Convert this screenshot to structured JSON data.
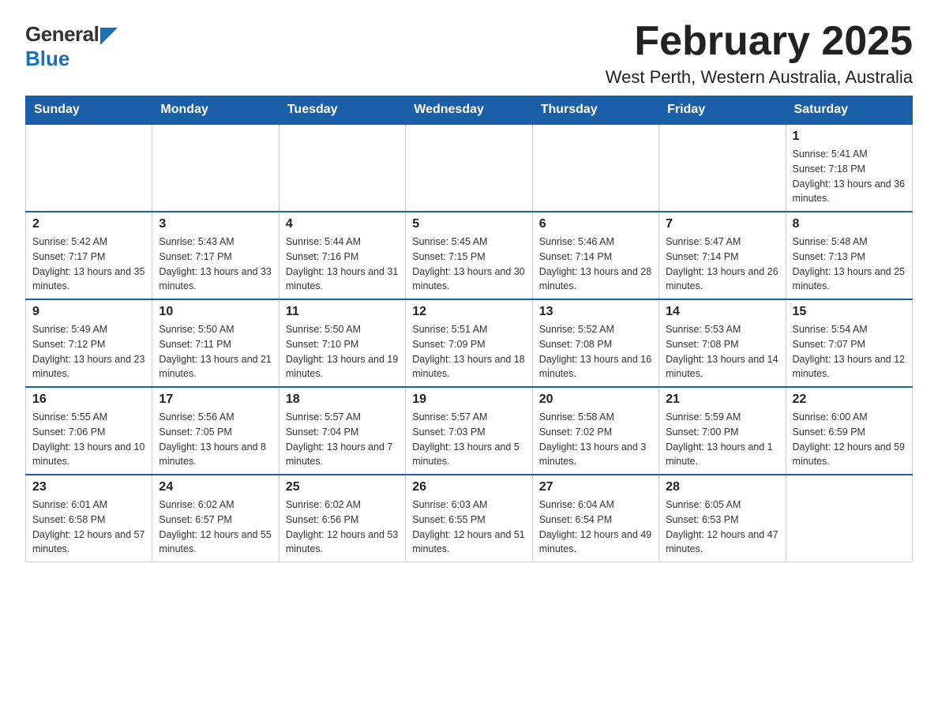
{
  "header": {
    "logo_general": "General",
    "logo_blue": "Blue",
    "title": "February 2025",
    "subtitle": "West Perth, Western Australia, Australia"
  },
  "calendar": {
    "days_of_week": [
      "Sunday",
      "Monday",
      "Tuesday",
      "Wednesday",
      "Thursday",
      "Friday",
      "Saturday"
    ],
    "weeks": [
      [
        {
          "day": "",
          "info": ""
        },
        {
          "day": "",
          "info": ""
        },
        {
          "day": "",
          "info": ""
        },
        {
          "day": "",
          "info": ""
        },
        {
          "day": "",
          "info": ""
        },
        {
          "day": "",
          "info": ""
        },
        {
          "day": "1",
          "info": "Sunrise: 5:41 AM\nSunset: 7:18 PM\nDaylight: 13 hours and 36 minutes."
        }
      ],
      [
        {
          "day": "2",
          "info": "Sunrise: 5:42 AM\nSunset: 7:17 PM\nDaylight: 13 hours and 35 minutes."
        },
        {
          "day": "3",
          "info": "Sunrise: 5:43 AM\nSunset: 7:17 PM\nDaylight: 13 hours and 33 minutes."
        },
        {
          "day": "4",
          "info": "Sunrise: 5:44 AM\nSunset: 7:16 PM\nDaylight: 13 hours and 31 minutes."
        },
        {
          "day": "5",
          "info": "Sunrise: 5:45 AM\nSunset: 7:15 PM\nDaylight: 13 hours and 30 minutes."
        },
        {
          "day": "6",
          "info": "Sunrise: 5:46 AM\nSunset: 7:14 PM\nDaylight: 13 hours and 28 minutes."
        },
        {
          "day": "7",
          "info": "Sunrise: 5:47 AM\nSunset: 7:14 PM\nDaylight: 13 hours and 26 minutes."
        },
        {
          "day": "8",
          "info": "Sunrise: 5:48 AM\nSunset: 7:13 PM\nDaylight: 13 hours and 25 minutes."
        }
      ],
      [
        {
          "day": "9",
          "info": "Sunrise: 5:49 AM\nSunset: 7:12 PM\nDaylight: 13 hours and 23 minutes."
        },
        {
          "day": "10",
          "info": "Sunrise: 5:50 AM\nSunset: 7:11 PM\nDaylight: 13 hours and 21 minutes."
        },
        {
          "day": "11",
          "info": "Sunrise: 5:50 AM\nSunset: 7:10 PM\nDaylight: 13 hours and 19 minutes."
        },
        {
          "day": "12",
          "info": "Sunrise: 5:51 AM\nSunset: 7:09 PM\nDaylight: 13 hours and 18 minutes."
        },
        {
          "day": "13",
          "info": "Sunrise: 5:52 AM\nSunset: 7:08 PM\nDaylight: 13 hours and 16 minutes."
        },
        {
          "day": "14",
          "info": "Sunrise: 5:53 AM\nSunset: 7:08 PM\nDaylight: 13 hours and 14 minutes."
        },
        {
          "day": "15",
          "info": "Sunrise: 5:54 AM\nSunset: 7:07 PM\nDaylight: 13 hours and 12 minutes."
        }
      ],
      [
        {
          "day": "16",
          "info": "Sunrise: 5:55 AM\nSunset: 7:06 PM\nDaylight: 13 hours and 10 minutes."
        },
        {
          "day": "17",
          "info": "Sunrise: 5:56 AM\nSunset: 7:05 PM\nDaylight: 13 hours and 8 minutes."
        },
        {
          "day": "18",
          "info": "Sunrise: 5:57 AM\nSunset: 7:04 PM\nDaylight: 13 hours and 7 minutes."
        },
        {
          "day": "19",
          "info": "Sunrise: 5:57 AM\nSunset: 7:03 PM\nDaylight: 13 hours and 5 minutes."
        },
        {
          "day": "20",
          "info": "Sunrise: 5:58 AM\nSunset: 7:02 PM\nDaylight: 13 hours and 3 minutes."
        },
        {
          "day": "21",
          "info": "Sunrise: 5:59 AM\nSunset: 7:00 PM\nDaylight: 13 hours and 1 minute."
        },
        {
          "day": "22",
          "info": "Sunrise: 6:00 AM\nSunset: 6:59 PM\nDaylight: 12 hours and 59 minutes."
        }
      ],
      [
        {
          "day": "23",
          "info": "Sunrise: 6:01 AM\nSunset: 6:58 PM\nDaylight: 12 hours and 57 minutes."
        },
        {
          "day": "24",
          "info": "Sunrise: 6:02 AM\nSunset: 6:57 PM\nDaylight: 12 hours and 55 minutes."
        },
        {
          "day": "25",
          "info": "Sunrise: 6:02 AM\nSunset: 6:56 PM\nDaylight: 12 hours and 53 minutes."
        },
        {
          "day": "26",
          "info": "Sunrise: 6:03 AM\nSunset: 6:55 PM\nDaylight: 12 hours and 51 minutes."
        },
        {
          "day": "27",
          "info": "Sunrise: 6:04 AM\nSunset: 6:54 PM\nDaylight: 12 hours and 49 minutes."
        },
        {
          "day": "28",
          "info": "Sunrise: 6:05 AM\nSunset: 6:53 PM\nDaylight: 12 hours and 47 minutes."
        },
        {
          "day": "",
          "info": ""
        }
      ]
    ]
  }
}
